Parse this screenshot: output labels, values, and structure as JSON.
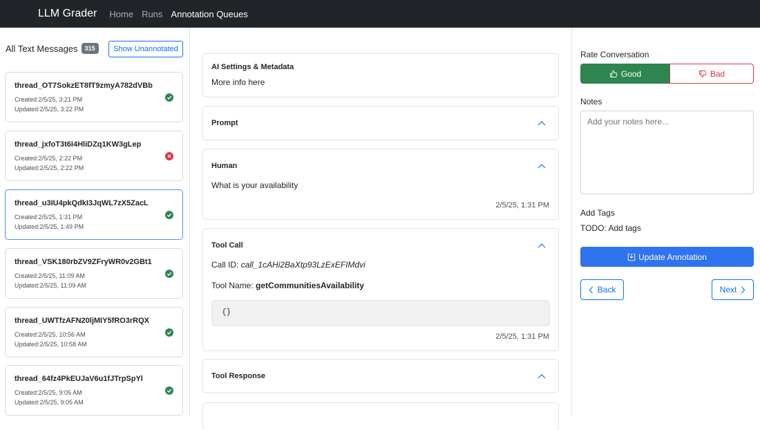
{
  "navbar": {
    "brand": "LLM Grader",
    "links": [
      "Home",
      "Runs",
      "Annotation Queues"
    ],
    "active": "Annotation Queues"
  },
  "sidebar": {
    "title": "All Text Messages",
    "count": "315",
    "filter_button": "Show Unannotated",
    "threads": [
      {
        "id": "thread_OT7SokzET8fT9zmyA782dVBb",
        "created": "Created:2/5/25, 3:21 PM",
        "updated": "Updated:2/5/25, 3:22 PM",
        "status": "good"
      },
      {
        "id": "thread_jxfoT3t6I4HliDZq1KW3gLep",
        "created": "Created:2/5/25, 2:22 PM",
        "updated": "Updated:2/5/25, 2:22 PM",
        "status": "bad"
      },
      {
        "id": "thread_u3IU4pkQdkI3JqWL7zX5ZacL",
        "created": "Created:2/5/25, 1:31 PM",
        "updated": "Updated:2/5/25, 1:49 PM",
        "status": "good"
      },
      {
        "id": "thread_VSK180rbZV9ZFryWR0v2GBt1",
        "created": "Created:2/5/25, 11:09 AM",
        "updated": "Updated:2/5/25, 11:09 AM",
        "status": "good"
      },
      {
        "id": "thread_UWTfzAFN20ljMIY5fRO3rRQX",
        "created": "Created:2/5/25, 10:56 AM",
        "updated": "Updated:2/5/25, 10:58 AM",
        "status": "good"
      },
      {
        "id": "thread_64fz4PkEUJaV6u1fJTrpSpYl",
        "created": "Created:2/5/25, 9:05 AM",
        "updated": "Updated:2/5/25, 9:05 AM",
        "status": "good"
      }
    ]
  },
  "main": {
    "ai_settings": {
      "title": "AI Settings & Metadata",
      "text": "More info here"
    },
    "prompt": {
      "title": "Prompt"
    },
    "human": {
      "title": "Human",
      "text": "What is your availability",
      "time": "2/5/25, 1:31 PM"
    },
    "tool_call": {
      "title": "Tool Call",
      "call_id_label": "Call ID: ",
      "call_id": "call_1cAHi2BaXtp93LzExEFIMdvi",
      "tool_name_label": "Tool Name: ",
      "tool_name": "getCommunitiesAvailability",
      "args": "{}",
      "time": "2/5/25, 1:31 PM"
    },
    "tool_response": {
      "title": "Tool Response"
    }
  },
  "annotation": {
    "rate_label": "Rate Conversation",
    "good_label": "Good",
    "bad_label": "Bad",
    "notes_label": "Notes",
    "notes_placeholder": "Add your notes here...",
    "notes_value": "",
    "tags_label": "Add Tags",
    "tags_todo": "TODO: Add tags",
    "update_label": "Update Annotation",
    "back_label": "Back",
    "next_label": "Next"
  },
  "colors": {
    "navbar_bg": "#212529",
    "primary": "#0d6efd",
    "success": "#2e8550",
    "danger": "#dc3545",
    "badge": "#6c757d"
  }
}
